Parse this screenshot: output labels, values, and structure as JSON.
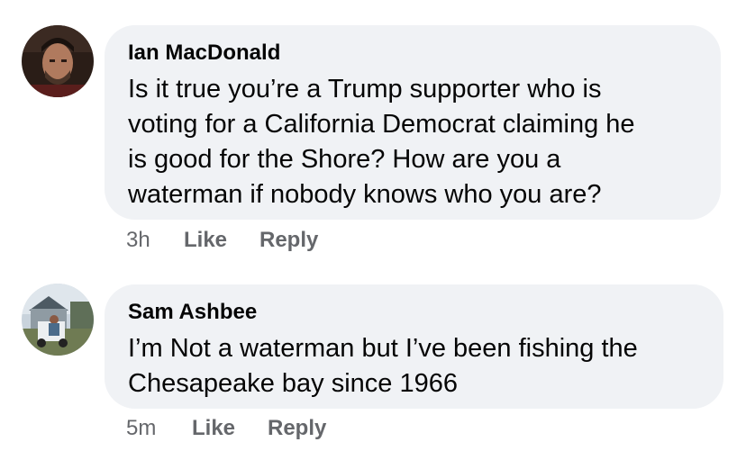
{
  "comments": [
    {
      "author": "Ian MacDonald",
      "text": "Is it true you’re a Trump supporter who is\nvoting for a California Democrat claiming he\nis good for the Shore? How are you a\nwaterman if nobody knows who you are?",
      "time": "3h",
      "like_label": "Like",
      "reply_label": "Reply"
    },
    {
      "author": "Sam Ashbee",
      "text": "I’m Not a waterman but I’ve been fishing the\nChesapeake bay since 1966",
      "time": "5m",
      "like_label": "Like",
      "reply_label": "Reply"
    }
  ],
  "colors": {
    "bubble": "#f0f2f5",
    "text": "#050505",
    "meta": "#65676b"
  }
}
